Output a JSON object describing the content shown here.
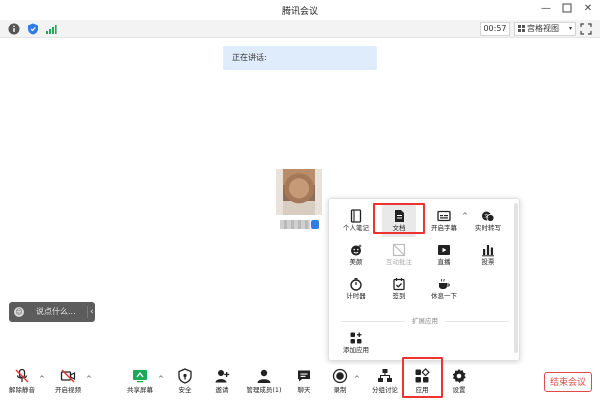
{
  "window": {
    "title": "腾讯会议"
  },
  "infobar": {
    "timer": "00:57",
    "view_label": "宫格视图"
  },
  "speaking_banner": {
    "text": "正在讲话:"
  },
  "chat": {
    "placeholder": "说点什么..."
  },
  "apps_popup": {
    "items": [
      {
        "label": "个人笔记",
        "icon": "notebook-icon"
      },
      {
        "label": "文档",
        "icon": "document-icon"
      },
      {
        "label": "开启字幕",
        "icon": "subtitle-icon"
      },
      {
        "label": "实时转写",
        "icon": "transcribe-icon"
      },
      {
        "label": "美颜",
        "icon": "beauty-icon"
      },
      {
        "label": "互动批注",
        "icon": "annotate-icon"
      },
      {
        "label": "直播",
        "icon": "live-icon"
      },
      {
        "label": "投票",
        "icon": "vote-icon"
      },
      {
        "label": "计时器",
        "icon": "timer-icon"
      },
      {
        "label": "签到",
        "icon": "checkin-icon"
      },
      {
        "label": "休息一下",
        "icon": "coffee-icon"
      }
    ],
    "expand_section_label": "扩展应用",
    "add_app_label": "添加应用"
  },
  "toolbar": {
    "buttons": [
      {
        "label": "解除静音",
        "icon": "mic-muted-icon"
      },
      {
        "label": "开启视频",
        "icon": "camera-off-icon"
      },
      {
        "label": "共享屏幕",
        "icon": "share-screen-icon"
      },
      {
        "label": "安全",
        "icon": "shield-icon"
      },
      {
        "label": "邀请",
        "icon": "invite-icon"
      },
      {
        "label": "管理成员(1)",
        "icon": "members-icon"
      },
      {
        "label": "聊天",
        "icon": "chat-icon"
      },
      {
        "label": "录制",
        "icon": "record-icon"
      },
      {
        "label": "分组讨论",
        "icon": "breakout-icon"
      },
      {
        "label": "应用",
        "icon": "apps-icon"
      },
      {
        "label": "设置",
        "icon": "settings-icon"
      }
    ],
    "end_meeting_label": "结束会议"
  },
  "colors": {
    "accent": "#2f7ce7",
    "danger": "#e33333",
    "banner": "#dfecfb",
    "share_green": "#1aaa55"
  }
}
